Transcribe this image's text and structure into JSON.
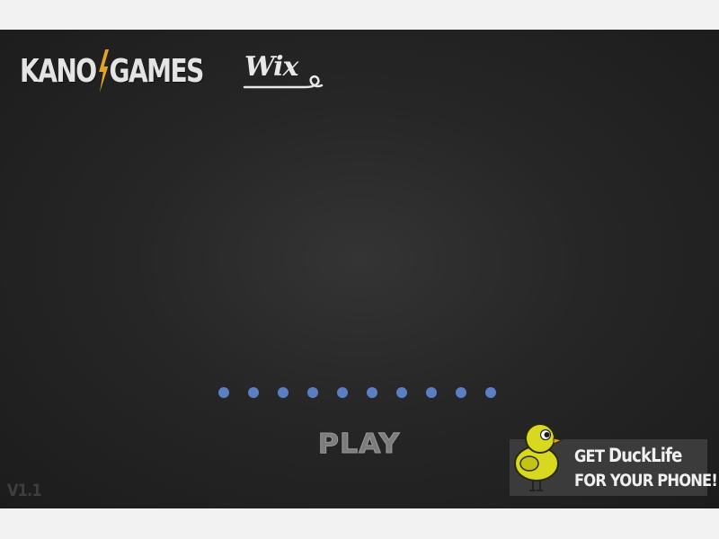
{
  "logos": {
    "kano_left": "KANO",
    "kano_right": "GAMES",
    "wix": "Wix"
  },
  "loader": {
    "dot_count": 10,
    "dot_color": "#5b7fc4"
  },
  "play_label": "PLAY",
  "version": "V1.1",
  "promo": {
    "line1_prefix": "GET ",
    "brand": "DuckLife",
    "line2": "FOR YOUR PHONE!"
  },
  "colors": {
    "background": "#262626",
    "accent_bolt": "#e2a32a",
    "duck": "#d8d820"
  }
}
